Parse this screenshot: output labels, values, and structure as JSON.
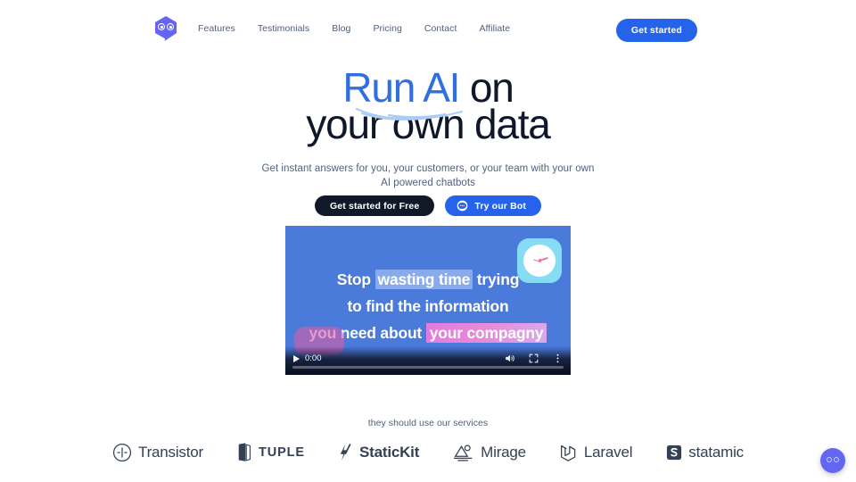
{
  "header": {
    "logo_name": "owl-hexagon-logo",
    "nav": [
      {
        "label": "Features"
      },
      {
        "label": "Testimonials"
      },
      {
        "label": "Blog"
      },
      {
        "label": "Pricing"
      },
      {
        "label": "Contact"
      },
      {
        "label": "Affiliate"
      }
    ],
    "cta_label": "Get started",
    "cta_color": "#2563eb",
    "brand_color": "#6366f1"
  },
  "hero": {
    "headline_accent": "Run AI",
    "headline_rest": " on",
    "headline_line2": "your own data",
    "accent_color": "#2f6fe0",
    "headline_color": "#0f172a",
    "subhead_line1": "Get instant answers for you, your customers, or your team with your own",
    "subhead_line2": "AI powered chatbots",
    "primary_cta": "Get started for Free",
    "secondary_cta": "Try our Bot",
    "secondary_icon": "chat-bubble-icon"
  },
  "video": {
    "line1_plain": "Stop ",
    "line1_highlight": "wasting time",
    "line1_tail": " trying",
    "line2": "to find the information",
    "line3_plain": "you need about ",
    "line3_highlight": "your compagny",
    "background_color": "#4a7ada",
    "highlight_blue": "#bed2fa",
    "highlight_pink": "#e27ae0",
    "clock_icon": "clock-icon",
    "controls": {
      "play_label": "play-button",
      "current_time": "0:00",
      "volume_icon": "volume-icon",
      "fullscreen_icon": "fullscreen-icon",
      "menu_icon": "more-options-icon"
    }
  },
  "logo_cloud": {
    "caption": "they should use our services",
    "logos": [
      {
        "name": "Transistor",
        "icon": "transistor-icon"
      },
      {
        "name": "TUPLE",
        "icon": "tuple-icon"
      },
      {
        "name": "StaticKit",
        "icon": "statickit-icon"
      },
      {
        "name": "Mirage",
        "icon": "mirage-icon"
      },
      {
        "name": "Laravel",
        "icon": "laravel-icon"
      },
      {
        "name": "statamic",
        "icon": "statamic-icon"
      }
    ]
  },
  "chat_widget": {
    "name": "chat-widget-button",
    "color": "#6366f1"
  }
}
